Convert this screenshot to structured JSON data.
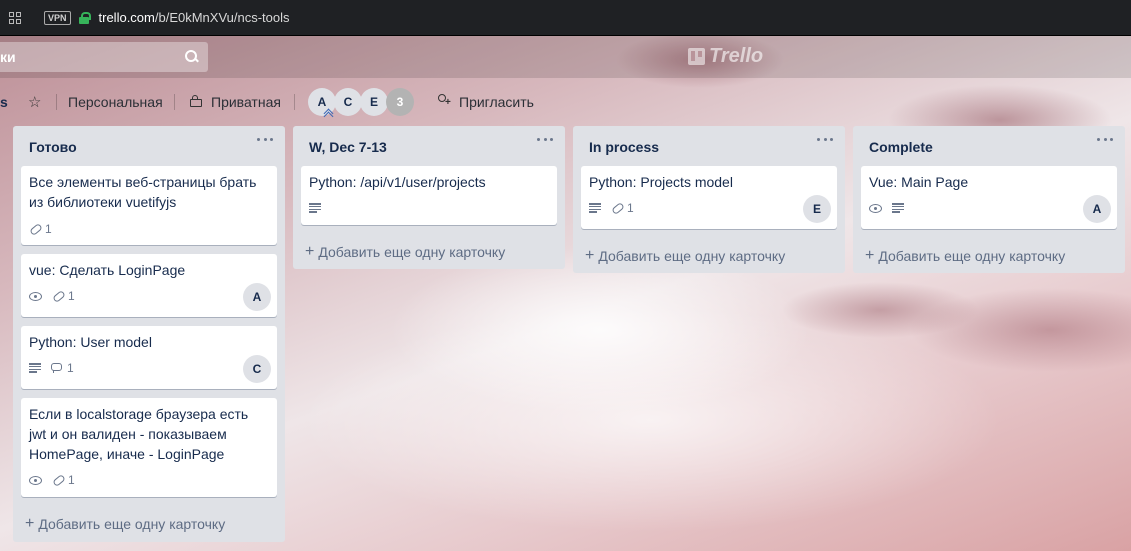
{
  "browser": {
    "vpn_label": "VPN",
    "url_host": "trello.com",
    "url_path": "/b/E0kMnXVu/ncs-tools"
  },
  "header": {
    "search_left_text": "ки",
    "logo_text": "Trello"
  },
  "board": {
    "name_fragment": "s",
    "team_label": "Персональная",
    "visibility_label": "Приватная",
    "members": [
      "A",
      "C",
      "E"
    ],
    "more_members": "3",
    "invite_label": "Пригласить"
  },
  "lists": [
    {
      "title": "Готово",
      "cards": [
        {
          "title": "Все элементы веб-страницы брать из библиотеки vuetifyjs",
          "attachments": "1"
        },
        {
          "title": "vue: Сделать LoginPage",
          "attachments": "1",
          "member": "A"
        },
        {
          "title": "Python: User model",
          "comments": "1",
          "member": "C"
        },
        {
          "title": "Если в localstorage браузера есть jwt и он валиден - показываем HomePage, иначе - LoginPage",
          "attachments": "1"
        }
      ],
      "add_card": "Добавить еще одну карточку"
    },
    {
      "title": "W, Dec 7-13",
      "cards": [
        {
          "title": "Python: /api/v1/user/projects"
        }
      ],
      "add_card": "Добавить еще одну карточку"
    },
    {
      "title": "In process",
      "cards": [
        {
          "title": "Python: Projects model",
          "attachments": "1",
          "member": "E"
        }
      ],
      "add_card": "Добавить еще одну карточку"
    },
    {
      "title": "Complete",
      "cards": [
        {
          "title": "Vue: Main Page",
          "member": "A"
        }
      ],
      "add_card": "Добавить еще одну карточку"
    }
  ],
  "colors": {
    "list_bg": "#dfe1e6",
    "card_bg": "#ffffff",
    "text": "#172b4d",
    "muted": "#5e6c84",
    "lock_green": "#36b35a"
  }
}
